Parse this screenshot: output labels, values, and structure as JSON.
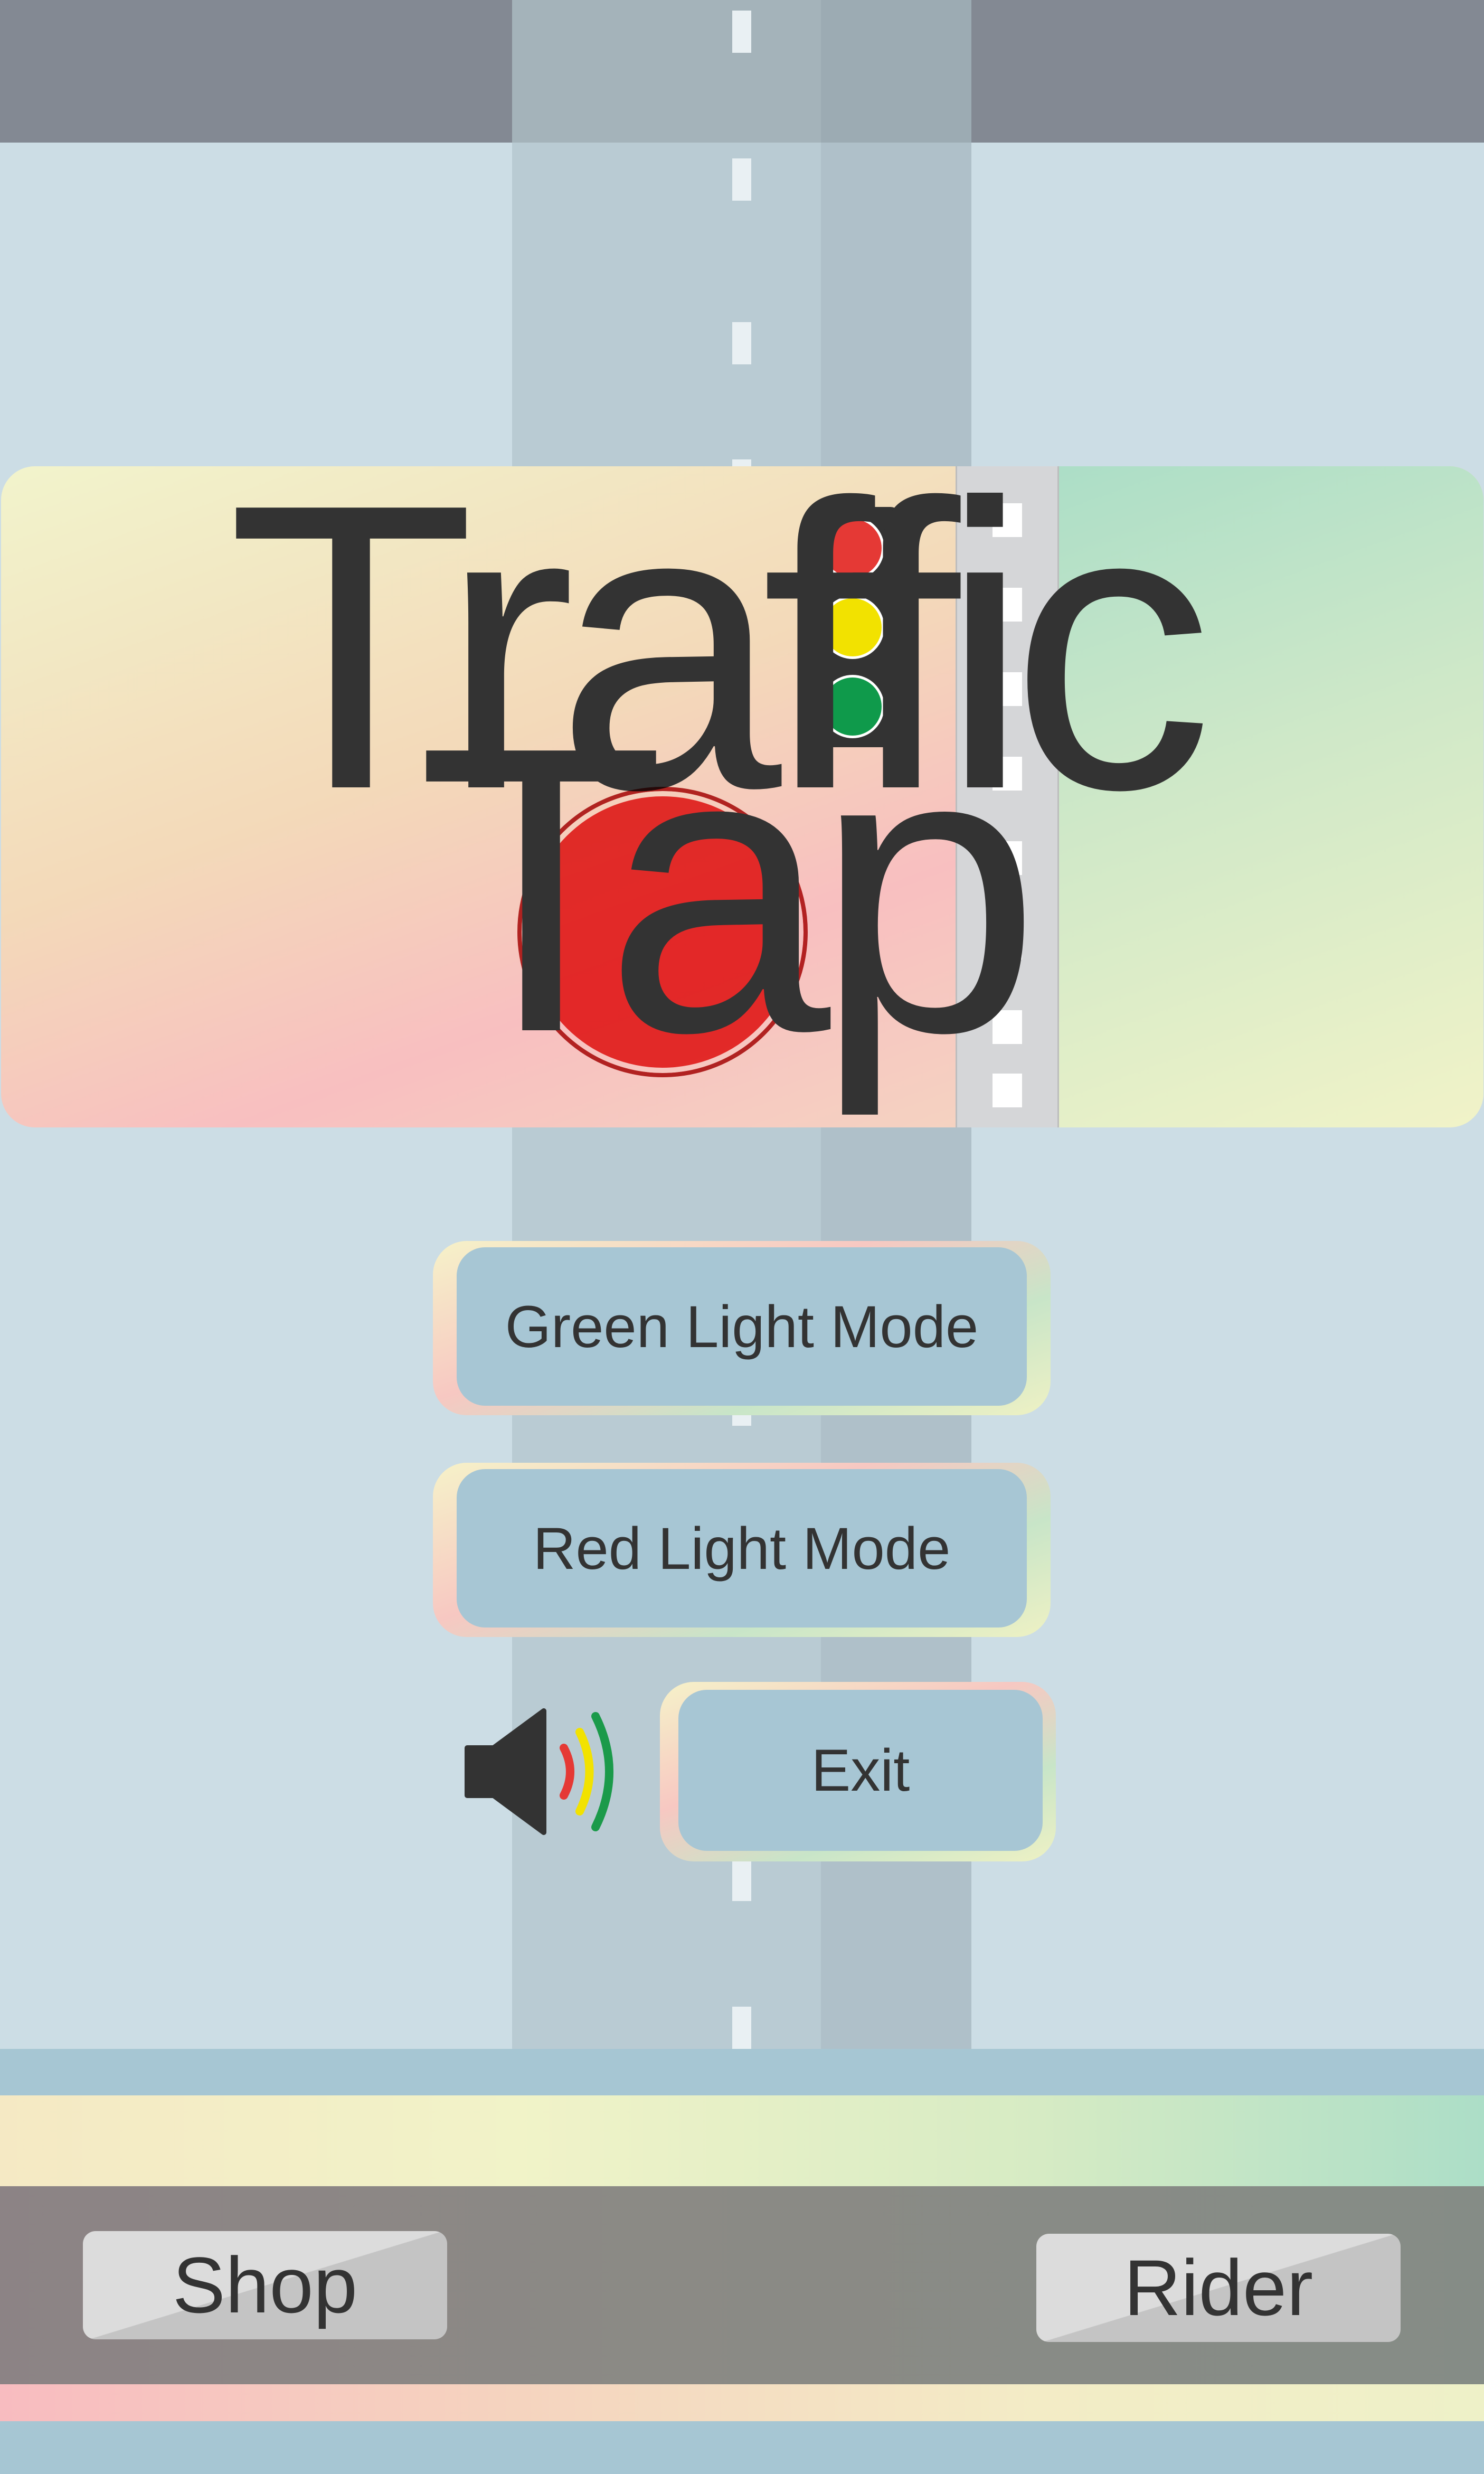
{
  "title": {
    "line1": "Traffic",
    "line2": "Tap"
  },
  "menu": {
    "green_light_mode": "Green Light Mode",
    "red_light_mode": "Red Light Mode",
    "exit": "Exit"
  },
  "sound": {
    "icon": "speaker-volume-icon",
    "wave_colors": [
      "#e53935",
      "#f2e200",
      "#1b9a4a"
    ]
  },
  "bottom_nav": {
    "shop": "Shop",
    "rider": "Rider"
  },
  "traffic_light": {
    "lamps": [
      "#e53935",
      "#f2e200",
      "#0f9a4b"
    ]
  },
  "colors": {
    "button_fill": "#a7c6d4",
    "text": "#333333",
    "background": "#ccdde5"
  }
}
